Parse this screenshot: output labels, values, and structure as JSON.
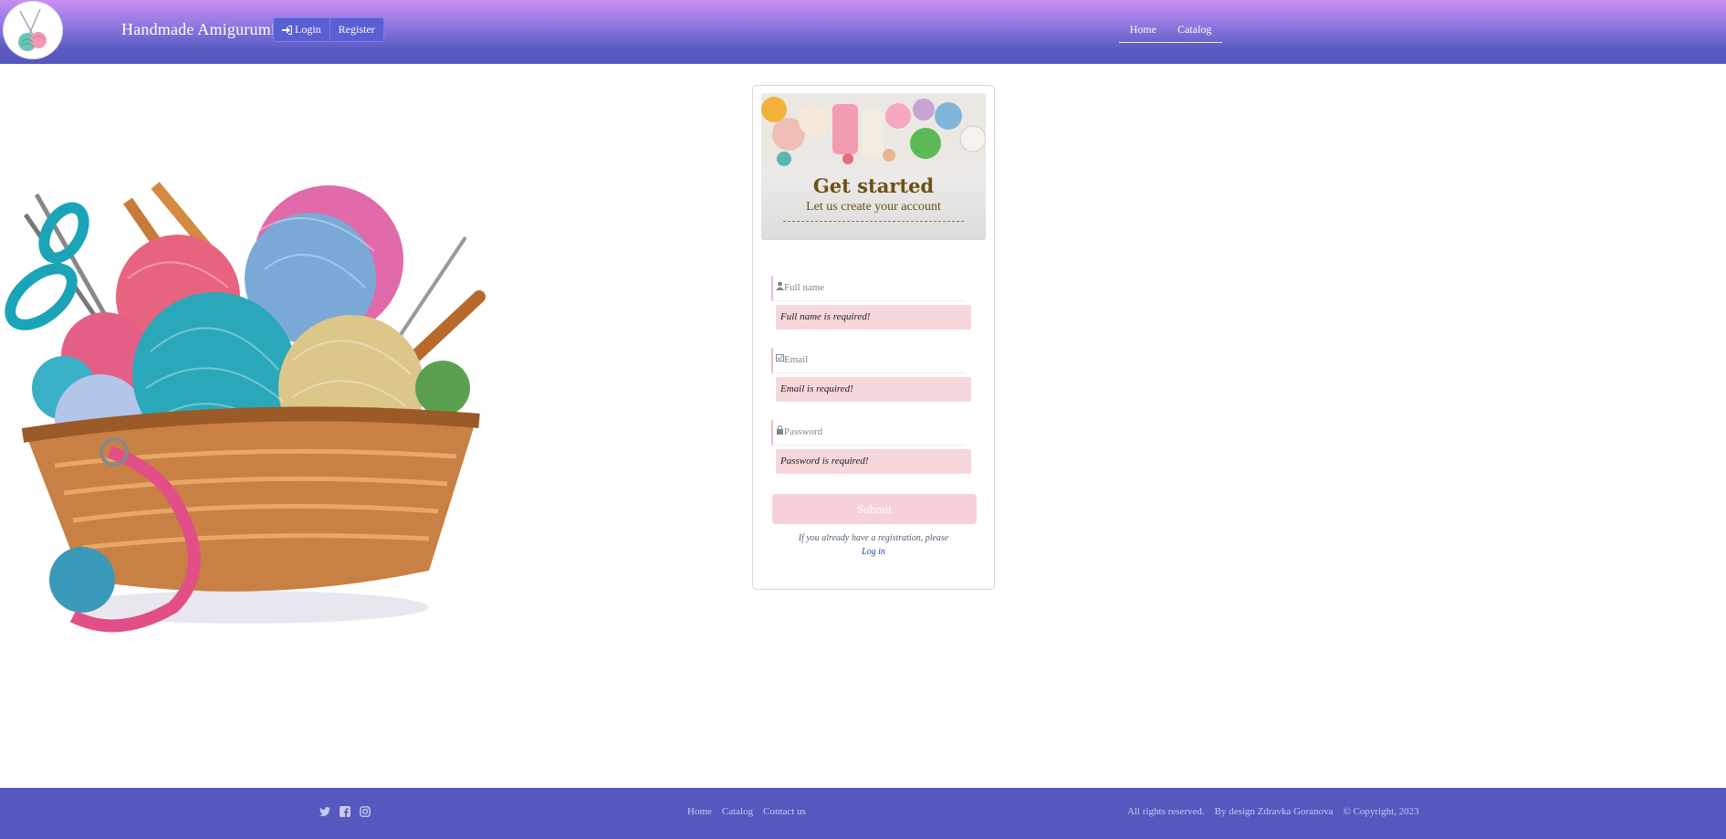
{
  "header": {
    "brand": "Handmade Amigurumi",
    "auth": {
      "login_label": "Login",
      "register_label": "Register"
    },
    "nav": [
      {
        "label": "Home"
      },
      {
        "label": "Catalog"
      }
    ]
  },
  "form": {
    "banner_title": "Get started",
    "banner_subtitle": "Let us create your account",
    "fields": [
      {
        "placeholder": "Full name",
        "icon": "user-icon",
        "error": "Full name is required!"
      },
      {
        "placeholder": "Email",
        "icon": "envelope-check-icon",
        "error": "Email is required!"
      },
      {
        "placeholder": "Password",
        "icon": "lock-icon",
        "error": "Password is required!"
      }
    ],
    "submit_label": "Submit",
    "note": "If you already have a registration, please",
    "login_link": "Log in"
  },
  "footer": {
    "socials": [
      "twitter-icon",
      "facebook-icon",
      "instagram-icon"
    ],
    "links": [
      {
        "label": "Home"
      },
      {
        "label": "Catalog"
      },
      {
        "label": "Contact us"
      }
    ],
    "rights": "All rights reserved.",
    "design": "By design Zdravka Goranova",
    "copyright": "© Copyright, 2023"
  },
  "colors": {
    "header_top": "#c98ef0",
    "header_bottom": "#5558bf",
    "footer": "#5558bf",
    "error_bg": "#f6d7db",
    "submit_bg": "#f6d2d8",
    "banner_text": "#6b5115"
  }
}
